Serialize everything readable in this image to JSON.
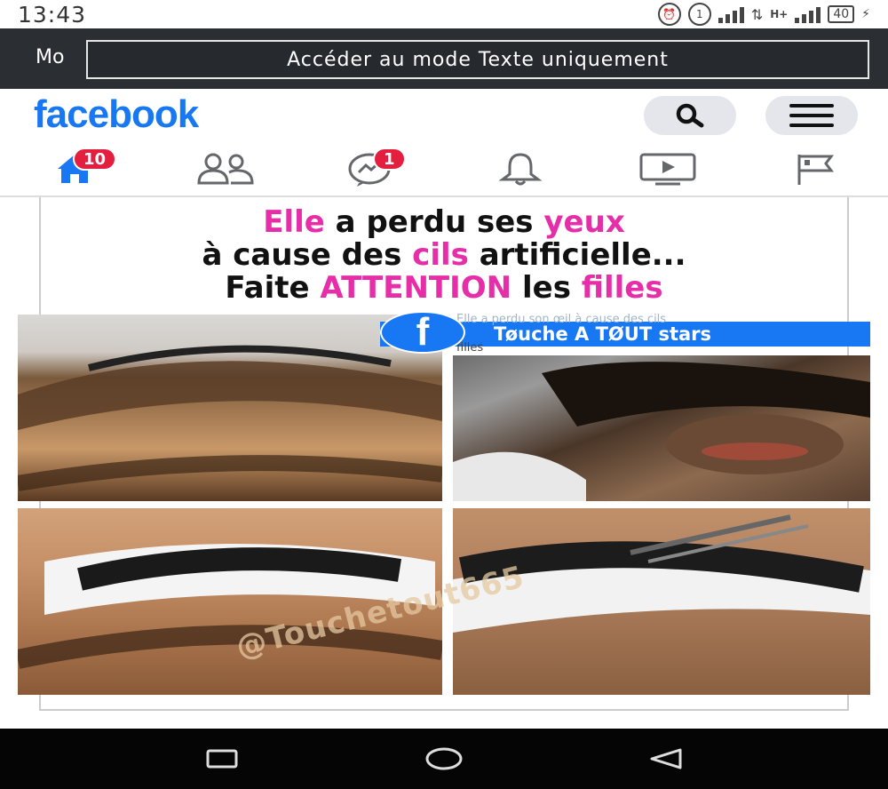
{
  "status_bar": {
    "time": "13:43",
    "battery_level": "40",
    "data_label": "H+"
  },
  "text_mode": {
    "left_fragment": "Mo",
    "button_label": "Accéder au mode Texte uniquement"
  },
  "header": {
    "logo": "facebook",
    "brand_color": "#1877f2"
  },
  "nav": {
    "home_badge": "10",
    "messages_badge": "1",
    "tabs": [
      "home-icon",
      "friends-icon",
      "messenger-icon",
      "notifications-icon",
      "watch-icon",
      "pages-icon"
    ]
  },
  "post": {
    "headline_line1": [
      "Elle",
      " a perdu ses ",
      "yeux"
    ],
    "headline_line2": [
      "à cause des ",
      "cils",
      " artificielle..."
    ],
    "headline_line3": [
      "Faite ",
      "ATTENTION",
      " les ",
      "filles"
    ],
    "page_name": "Tøuche A TØUT stars",
    "overlay_caption_line1": "Elle a perdu son œil à cause des cils",
    "overlay_caption_line2": "filles",
    "image_watermark": "@Touchetout665",
    "accent_color": "#e62ea8"
  }
}
